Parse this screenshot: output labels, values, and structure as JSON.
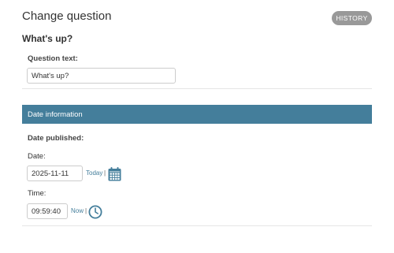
{
  "header": {
    "title": "Change question",
    "history_label": "HISTORY",
    "object_title": "What's up?"
  },
  "question_fieldset": {
    "question_text_label": "Question text:",
    "question_text_value": "What's up?"
  },
  "date_fieldset": {
    "section_title": "Date information",
    "pub_date_label": "Date published:",
    "date_label": "Date:",
    "date_value": "2025-11-11",
    "today_link": "Today",
    "time_label": "Time:",
    "time_value": "09:59:40",
    "now_link": "Now",
    "separator": "|"
  },
  "icons": {
    "calendar": "calendar-icon",
    "clock": "clock-icon"
  },
  "colors": {
    "accent": "#447e9b",
    "history_button": "#999999"
  }
}
